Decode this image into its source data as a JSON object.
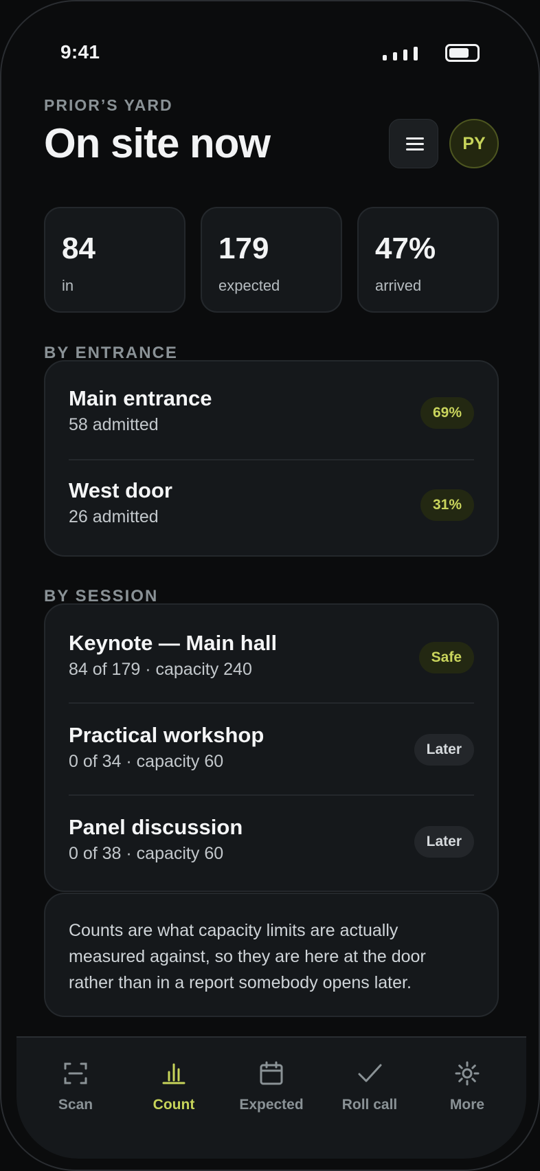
{
  "status_bar": {
    "time": "9:41"
  },
  "header": {
    "org_label": "PRIOR’S YARD",
    "title": "On site now",
    "avatar_initials": "PY"
  },
  "stats": [
    {
      "value": "84",
      "label": "in"
    },
    {
      "value": "179",
      "label": "expected"
    },
    {
      "value": "47%",
      "label": "arrived"
    }
  ],
  "by_entrance": {
    "label": "BY ENTRANCE",
    "items": [
      {
        "name": "Main entrance",
        "detail": "58 admitted",
        "badge": "69%"
      },
      {
        "name": "West door",
        "detail": "26 admitted",
        "badge": "31%"
      }
    ]
  },
  "by_session": {
    "label": "BY SESSION",
    "items": [
      {
        "name": "Keynote — Main hall",
        "detail": "84 of 179 · capacity 240",
        "badge": "Safe",
        "badge_style": "green"
      },
      {
        "name": "Practical workshop",
        "detail": "0 of 34 · capacity 60",
        "badge": "Later",
        "badge_style": "gray"
      },
      {
        "name": "Panel discussion",
        "detail": "0 of 38 · capacity 60",
        "badge": "Later",
        "badge_style": "gray"
      }
    ]
  },
  "note": "Counts are what capacity limits are actually measured against, so they are here at the door rather than in a report somebody opens later.",
  "tab_bar": [
    {
      "label": "Scan",
      "icon": "scan-icon",
      "active": false
    },
    {
      "label": "Count",
      "icon": "bar-chart-icon",
      "active": true
    },
    {
      "label": "Expected",
      "icon": "calendar-icon",
      "active": false
    },
    {
      "label": "Roll call",
      "icon": "check-icon",
      "active": false
    },
    {
      "label": "More",
      "icon": "gear-icon",
      "active": false
    }
  ],
  "colors": {
    "accent": "#c7d45a",
    "background": "#0b0c0d",
    "card": "#15181b"
  }
}
